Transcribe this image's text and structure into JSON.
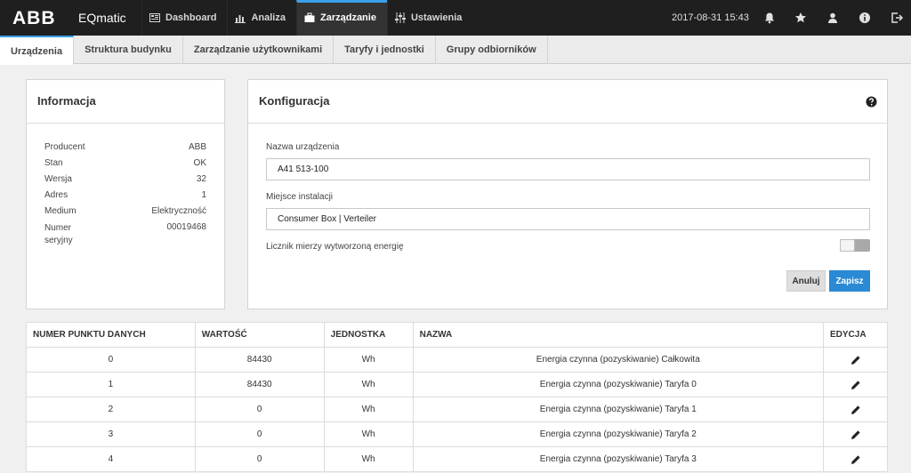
{
  "header": {
    "brand": "ABB",
    "app_name": "EQmatic",
    "nav": [
      {
        "label": "Dashboard",
        "icon": "dashboard-icon"
      },
      {
        "label": "Analiza",
        "icon": "bar-chart-icon"
      },
      {
        "label": "Zarządzanie",
        "icon": "briefcase-icon",
        "active": true
      },
      {
        "label": "Ustawienia",
        "icon": "sliders-icon"
      }
    ],
    "datetime": "2017-08-31 15:43",
    "icons": [
      "bell-icon",
      "star-icon",
      "user-icon",
      "info-icon",
      "logout-icon"
    ]
  },
  "tabs": [
    {
      "label": "Urządzenia",
      "active": true
    },
    {
      "label": "Struktura budynku"
    },
    {
      "label": "Zarządzanie użytkownikami"
    },
    {
      "label": "Taryfy i jednostki"
    },
    {
      "label": "Grupy odbiorników"
    }
  ],
  "info": {
    "title": "Informacja",
    "rows": [
      {
        "key": "Producent",
        "value": "ABB"
      },
      {
        "key": "Stan",
        "value": "OK"
      },
      {
        "key": "Wersja",
        "value": "32"
      },
      {
        "key": "Adres",
        "value": "1"
      },
      {
        "key": "Medium",
        "value": "Elektryczność"
      },
      {
        "key": "Numer seryjny",
        "value": "00019468"
      }
    ]
  },
  "config": {
    "title": "Konfiguracja",
    "name_label": "Nazwa urządzenia",
    "name_value": "A41 513-100",
    "location_label": "Miejsce instalacji",
    "location_value": "Consumer Box | Verteiler",
    "toggle_label": "Licznik mierzy wytworzoną energię",
    "toggle_on": false,
    "cancel_label": "Anuluj",
    "save_label": "Zapisz"
  },
  "table": {
    "headers": [
      "NUMER PUNKTU DANYCH",
      "WARTOŚĆ",
      "JEDNOSTKA",
      "NAZWA",
      "EDYCJA"
    ],
    "rows": [
      {
        "num": "0",
        "value": "84430",
        "unit": "Wh",
        "name": "Energia czynna (pozyskiwanie) Całkowita"
      },
      {
        "num": "1",
        "value": "84430",
        "unit": "Wh",
        "name": "Energia czynna (pozyskiwanie) Taryfa 0"
      },
      {
        "num": "2",
        "value": "0",
        "unit": "Wh",
        "name": "Energia czynna (pozyskiwanie) Taryfa 1"
      },
      {
        "num": "3",
        "value": "0",
        "unit": "Wh",
        "name": "Energia czynna (pozyskiwanie) Taryfa 2"
      },
      {
        "num": "4",
        "value": "0",
        "unit": "Wh",
        "name": "Energia czynna (pozyskiwanie) Taryfa 3"
      }
    ]
  },
  "colors": {
    "accent": "#3aa0e8",
    "save": "#2a8ad6",
    "topbar": "#1f1f1f"
  }
}
